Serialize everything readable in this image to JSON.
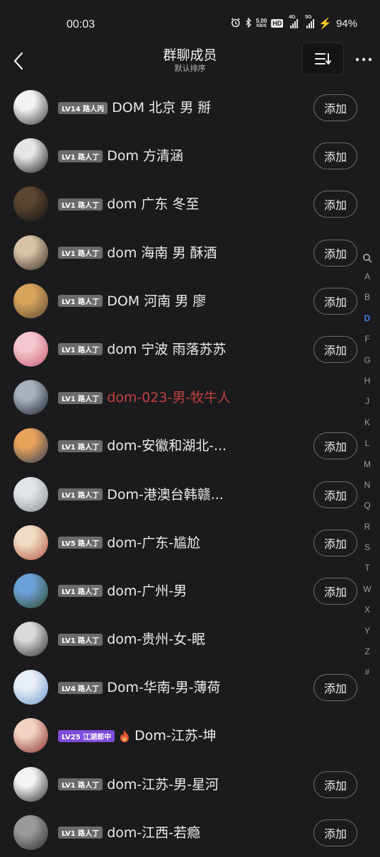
{
  "status_bar": {
    "time": "00:03",
    "net_speed_value": "5.00",
    "net_speed_unit": "KB/S",
    "hd_label": "HD",
    "sim1_tag": "4G",
    "sim2_tag": "5G",
    "battery": "94%"
  },
  "header": {
    "title": "群聊成员",
    "subtitle": "默认排序"
  },
  "add_label": "添加",
  "members": [
    {
      "level": "LV14 路人丙",
      "name": "DOM 北京 男 掰",
      "show_add": true,
      "badge_color": "#6b6b6e",
      "name_color": "#ececec",
      "avatar_colors": [
        "#f2f2f2",
        "#3a3a3a"
      ]
    },
    {
      "level": "LV1 路人丁",
      "name": "Dom 方清涵",
      "show_add": true,
      "badge_color": "#6b6b6e",
      "name_color": "#ececec",
      "avatar_colors": [
        "#e6e6e6",
        "#1e1e1e"
      ]
    },
    {
      "level": "LV1 路人丁",
      "name": "dom 广东 冬至",
      "show_add": true,
      "badge_color": "#6b6b6e",
      "name_color": "#ececec",
      "avatar_colors": [
        "#5a4530",
        "#141414"
      ]
    },
    {
      "level": "LV1 路人丁",
      "name": "dom 海南 男  酥酒",
      "show_add": true,
      "badge_color": "#6b6b6e",
      "name_color": "#ececec",
      "avatar_colors": [
        "#d8c2a8",
        "#3b2f26"
      ]
    },
    {
      "level": "LV1 路人丁",
      "name": "DOM 河南 男 廖",
      "show_add": true,
      "badge_color": "#6b6b6e",
      "name_color": "#ececec",
      "avatar_colors": [
        "#d7a45c",
        "#5e4a33"
      ]
    },
    {
      "level": "LV1 路人丁",
      "name": "dom 宁波 雨落苏苏",
      "show_add": true,
      "badge_color": "#6b6b6e",
      "name_color": "#ececec",
      "avatar_colors": [
        "#f4c6cf",
        "#c95d75"
      ]
    },
    {
      "level": "LV1 路人丁",
      "name": "dom-023-男-牧牛人",
      "show_add": false,
      "badge_color": "#6b6b6e",
      "name_color": "#c04141",
      "avatar_colors": [
        "#a9b1bc",
        "#1c2230"
      ]
    },
    {
      "level": "LV1 路人丁",
      "name": "dom-安徽和湖北-...",
      "show_add": true,
      "badge_color": "#6b6b6e",
      "name_color": "#ececec",
      "avatar_colors": [
        "#e9a25a",
        "#2c3c58"
      ]
    },
    {
      "level": "LV1 路人丁",
      "name": "Dom-港澳台韩赣...",
      "show_add": true,
      "badge_color": "#6b6b6e",
      "name_color": "#ececec",
      "avatar_colors": [
        "#dfe5e8",
        "#8b8f95"
      ]
    },
    {
      "level": "LV5 路人丁",
      "name": "dom-广东-尴尬",
      "show_add": true,
      "badge_color": "#6b6b6e",
      "name_color": "#ececec",
      "avatar_colors": [
        "#f0dcc6",
        "#b4563f"
      ]
    },
    {
      "level": "LV1 路人丁",
      "name": "dom-广州-男",
      "show_add": true,
      "badge_color": "#6b6b6e",
      "name_color": "#ececec",
      "avatar_colors": [
        "#6d9fd8",
        "#2d4a24"
      ]
    },
    {
      "level": "LV1 路人丁",
      "name": "dom-贵州-女-眠",
      "show_add": false,
      "badge_color": "#6b6b6e",
      "name_color": "#ececec",
      "avatar_colors": [
        "#d9d9d9",
        "#2a2a2a"
      ]
    },
    {
      "level": "LV4 路人丁",
      "name": "Dom-华南-男-薄荷",
      "show_add": true,
      "badge_color": "#6b6b6e",
      "name_color": "#ececec",
      "avatar_colors": [
        "#e8eef5",
        "#6f9bd1"
      ]
    },
    {
      "level": "LV25 江湖郎中",
      "name": "Dom-江苏-坤",
      "show_add": false,
      "badge_color": "#7d4dd8",
      "name_color": "#ececec",
      "flame": true,
      "avatar_colors": [
        "#f0d3c2",
        "#8a2b2b"
      ]
    },
    {
      "level": "LV1 路人丁",
      "name": "dom-江苏-男-星河",
      "show_add": true,
      "badge_color": "#6b6b6e",
      "name_color": "#ececec",
      "avatar_colors": [
        "#f4f4f4",
        "#2b2b2b"
      ]
    },
    {
      "level": "LV1 路人丁",
      "name": "dom-江西-若瘾",
      "show_add": true,
      "badge_color": "#6b6b6e",
      "name_color": "#ececec",
      "avatar_colors": [
        "#9a9a9a",
        "#2e2e2e"
      ]
    }
  ],
  "alphabet": [
    "A",
    "B",
    "D",
    "F",
    "G",
    "H",
    "J",
    "K",
    "L",
    "M",
    "N",
    "Q",
    "R",
    "S",
    "T",
    "W",
    "X",
    "Y",
    "Z",
    "#"
  ],
  "active_letter": "D"
}
